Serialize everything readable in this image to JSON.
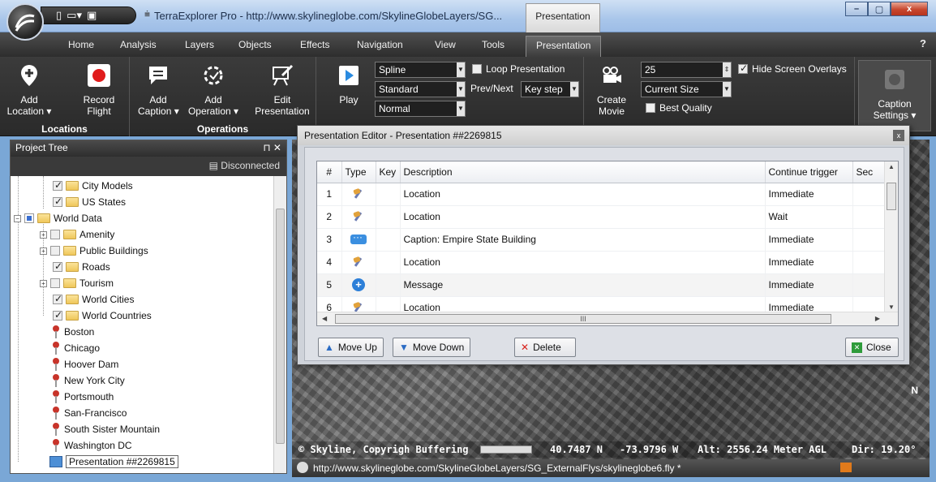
{
  "window": {
    "title": "TerraExplorer Pro - http://www.skylineglobe.com/SkylineGlobeLayers/SG...",
    "context_tab": "Presentation",
    "buttons": {
      "min": "–",
      "max": "▢",
      "close": "x"
    }
  },
  "tabs": [
    "Home",
    "Analysis",
    "Layers",
    "Objects",
    "Effects",
    "Navigation",
    "View",
    "Tools",
    "Presentation"
  ],
  "ribbon": {
    "locations": {
      "label": "Locations",
      "add_location": "Add\nLocation ▾",
      "record_flight": "Record\nFlight"
    },
    "operations": {
      "label": "Operations",
      "add_caption": "Add\nCaption ▾",
      "add_operation": "Add\nOperation ▾",
      "edit_presentation": "Edit\nPresentation"
    },
    "play": {
      "label": "Play",
      "spline": "Spline",
      "standard": "Standard",
      "normal": "Normal",
      "loop_presentation": "Loop Presentation",
      "prev_next": "Prev/Next",
      "key_step": "Key step"
    },
    "movie": {
      "label": "Create\nMovie",
      "fps": "25",
      "size": "Current Size",
      "best_quality": "Best Quality",
      "hide_overlays": "Hide Screen Overlays"
    },
    "caption_settings": "Caption\nSettings ▾"
  },
  "tree": {
    "header": "Project Tree",
    "header_ctl": "⊓ ✕",
    "status": "Disconnected",
    "nodes": [
      {
        "label": "City Models",
        "checked": true
      },
      {
        "label": "US States",
        "checked": true
      },
      {
        "label": "World Data",
        "checked": true
      },
      {
        "label": "Amenity",
        "checked": false
      },
      {
        "label": "Public Buildings",
        "checked": false
      },
      {
        "label": "Roads",
        "checked": true
      },
      {
        "label": "Tourism",
        "checked": false
      },
      {
        "label": "World Cities",
        "checked": true
      },
      {
        "label": "World Countries",
        "checked": true
      },
      {
        "label": "Boston"
      },
      {
        "label": "Chicago"
      },
      {
        "label": "Hoover Dam"
      },
      {
        "label": "New York City"
      },
      {
        "label": "Portsmouth"
      },
      {
        "label": "San-Francisco"
      },
      {
        "label": "South Sister Mountain"
      },
      {
        "label": "Washington DC"
      },
      {
        "label": "Presentation ##2269815"
      }
    ]
  },
  "editor": {
    "title": "Presentation Editor - Presentation ##2269815",
    "close_x": "x",
    "columns": [
      "#",
      "Type",
      "Key",
      "Description",
      "Continue trigger",
      "Sec"
    ],
    "rows": [
      {
        "num": "1",
        "type": "location",
        "description": "Location",
        "trigger": "Immediate"
      },
      {
        "num": "2",
        "type": "location",
        "description": "Location",
        "trigger": "Wait"
      },
      {
        "num": "3",
        "type": "caption",
        "description": "Caption: Empire State Building",
        "trigger": "Immediate"
      },
      {
        "num": "4",
        "type": "location",
        "description": "Location",
        "trigger": "Immediate"
      },
      {
        "num": "5",
        "type": "message",
        "description": "Message",
        "trigger": "Immediate"
      },
      {
        "num": "6",
        "type": "location",
        "description": "Location",
        "trigger": "Immediate"
      }
    ],
    "hscroll_grip": "III",
    "move_up": "Move Up",
    "move_down": "Move Down",
    "delete": "Delete",
    "close": "Close"
  },
  "map_status": {
    "copyright": "© Skyline, Copyrigh Buffering",
    "lat": "40.7487 N",
    "lon": "-73.9796 W",
    "alt": "Alt: 2556.24 Meter AGL",
    "dir": "Dir: 19.20°",
    "compass": "N"
  },
  "url_bar": "http://www.skylineglobe.com/SkylineGlobeLayers/SG_ExternalFlys/skylineglobe6.fly *",
  "colors": {
    "ribbon": "#2f2f2f",
    "accent": "#3b8fe0",
    "record": "#e01b1b"
  }
}
